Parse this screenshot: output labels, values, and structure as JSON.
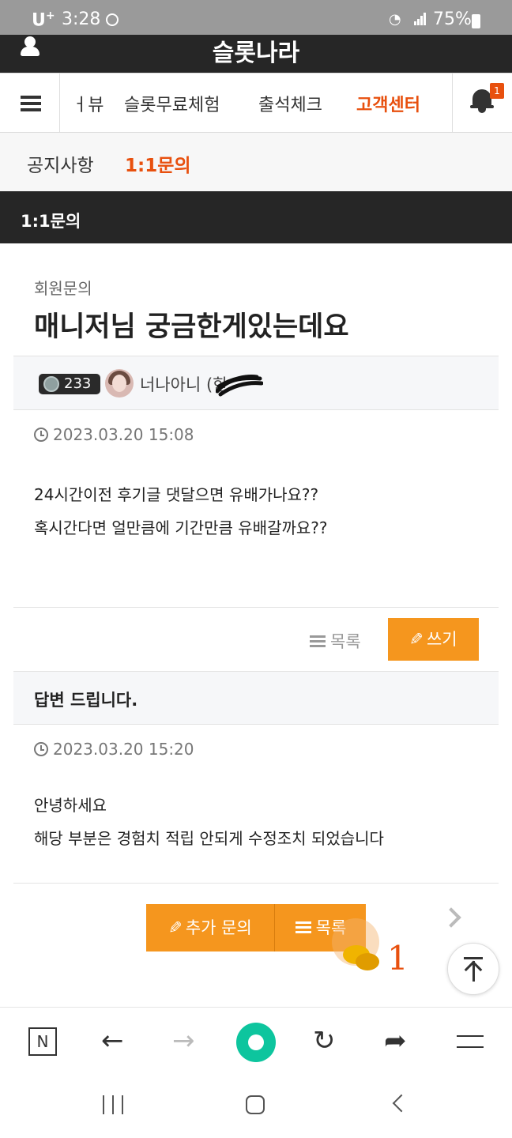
{
  "status_bar": {
    "carrier": "U",
    "carrier_sup": "+",
    "time": "3:28",
    "battery": "75%"
  },
  "top_bar": {
    "site_title": "슬롯나라"
  },
  "main_nav": {
    "items": [
      {
        "label": "ㅓ뷰"
      },
      {
        "label": "슬롯무료체험"
      },
      {
        "label": "출석체크"
      },
      {
        "label": "고객센터",
        "active": true
      }
    ],
    "notification_count": "1"
  },
  "sub_nav": {
    "tabs": [
      {
        "label": "공지사항"
      },
      {
        "label": "1:1문의",
        "active": true
      }
    ]
  },
  "section": {
    "title": "1:1문의"
  },
  "post": {
    "category": "회원문의",
    "title": "매니저님 궁금한게있는데요",
    "author": {
      "level": "233",
      "nickname": "너나아니 (한"
    },
    "date": "2023.03.20 15:08",
    "body_lines": [
      "24시간이전 후기글 댓달으면 유배가나요??",
      "혹시간다면 얼만큼에 기간만큼 유배갈까요??"
    ]
  },
  "actions": {
    "list_label": "목록",
    "write_label": "쓰기"
  },
  "answer": {
    "header": "답변 드립니다.",
    "date": "2023.03.20 15:20",
    "body_lines": [
      "안녕하세요",
      "해당 부분은 경험치 적립 안되게 수정조치 되었습니다"
    ]
  },
  "bottom_actions": {
    "more_inquiry_label": "추가 문의",
    "list_label": "목록"
  },
  "chat_widget": {
    "count": "1"
  },
  "browser_bar": {
    "n_label": "N",
    "back_glyph": "←",
    "forward_glyph": "→",
    "refresh_glyph": "↻",
    "share_glyph": "➦"
  },
  "colors": {
    "accent_orange": "#e8500e",
    "button_orange": "#f5961e",
    "dark_bar": "#262626",
    "home_green": "#0dc59e"
  }
}
